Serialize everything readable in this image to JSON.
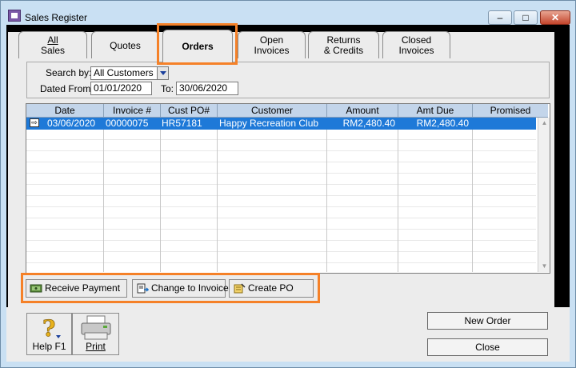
{
  "window": {
    "title": "Sales Register",
    "minimize_glyph": "–",
    "maximize_glyph": "□",
    "close_glyph": "✕"
  },
  "tabs": [
    {
      "line1": "All",
      "line2": "Sales"
    },
    {
      "line1": "Quotes",
      "line2": ""
    },
    {
      "line1": "Orders",
      "line2": ""
    },
    {
      "line1": "Open",
      "line2": "Invoices"
    },
    {
      "line1": "Returns",
      "line2": "& Credits"
    },
    {
      "line1": "Closed",
      "line2": "Invoices"
    }
  ],
  "active_tab": "Orders",
  "filters": {
    "search_by_label": "Search by:",
    "search_by_value": "All Customers",
    "dated_from_label": "Dated From:",
    "dated_from_value": "01/01/2020",
    "to_label": "To:",
    "to_value": "30/06/2020"
  },
  "table": {
    "columns": [
      "Date",
      "Invoice #",
      "Cust PO#",
      "Customer",
      "Amount",
      "Amt Due",
      "Promised"
    ],
    "rows": [
      {
        "date": "03/06/2020",
        "invoice": "00000075",
        "cust_po": "HR57181",
        "customer": "Happy Recreation Club",
        "amount": "RM2,480.40",
        "amt_due": "RM2,480.40",
        "promised": ""
      }
    ]
  },
  "actions": {
    "receive_payment": "Receive Payment",
    "change_to_invoice": "Change to Invoice",
    "create_po": "Create PO"
  },
  "bottom": {
    "help": "Help F1",
    "print": "Print",
    "new_order": "New Order",
    "close": "Close"
  },
  "colors": {
    "highlight": "#f58128",
    "selected_row": "#1e79d8",
    "header_bg": "#c3d5ea",
    "frame": "#c9e0f3"
  },
  "icons": [
    "app-icon",
    "minimize-icon",
    "maximize-icon",
    "close-icon",
    "dropdown-arrow-icon",
    "row-arrow-icon",
    "receive-payment-icon",
    "change-to-invoice-icon",
    "create-po-icon",
    "help-icon",
    "printer-icon"
  ]
}
